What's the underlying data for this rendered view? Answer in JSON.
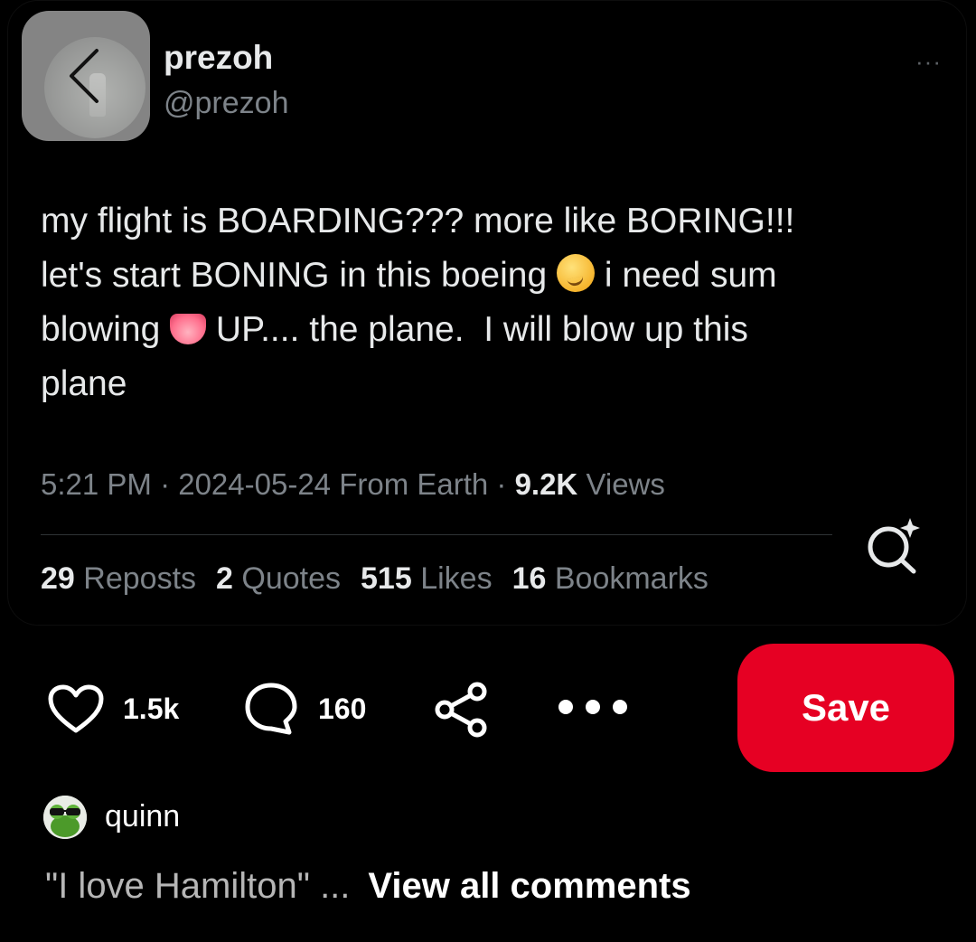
{
  "tweet": {
    "display_name": "prezoh",
    "handle": "@prezoh",
    "more_glyph": "···",
    "text_part1": "my flight is BOARDING??? more like BORING!!!\nlet's start BONING in this boeing ",
    "emoji1": "smirking-face",
    "text_part2": " i need sum\nblowing ",
    "emoji2": "tongue",
    "text_part3": " UP.... the plane.  I will blow up this\nplane",
    "meta_prefix": "5:21 PM · 2024-05-24 From Earth · ",
    "views_count": "9.2K",
    "views_label": " Views",
    "stats": [
      {
        "count": "29",
        "label": "Reposts"
      },
      {
        "count": "2",
        "label": "Quotes"
      },
      {
        "count": "515",
        "label": "Likes"
      },
      {
        "count": "16",
        "label": "Bookmarks"
      }
    ]
  },
  "actions": {
    "like_count": "1.5k",
    "comment_count": "160",
    "save_label": "Save"
  },
  "comment": {
    "author": "quinn",
    "snippet": "\"I love Hamilton\" ...",
    "view_all_label": "View all comments"
  },
  "colors": {
    "save": "#e60023",
    "muted": "#7d8389",
    "text": "#e7e9ea"
  }
}
